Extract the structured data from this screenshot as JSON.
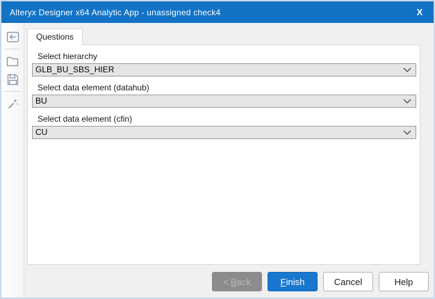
{
  "window": {
    "title": "Alteryx Designer x64 Analytic App - unassigned check4",
    "close_glyph": "X"
  },
  "colors": {
    "titlebar_blue": "#1273c6",
    "primary_button_blue": "#1877cf",
    "disabled_button_gray": "#8c8c8c",
    "combo_gray": "#e5e5e5",
    "window_border": "#c9d8ea"
  },
  "sidebar": {
    "icons": [
      {
        "name": "back-panel-icon"
      },
      {
        "name": "open-folder-icon"
      },
      {
        "name": "save-icon"
      },
      {
        "name": "magic-wand-icon"
      }
    ]
  },
  "tabs": [
    {
      "label": "Questions"
    }
  ],
  "questions": [
    {
      "label": "Select hierarchy",
      "value": "GLB_BU_SBS_HIER"
    },
    {
      "label": "Select data element (datahub)",
      "value": "BU"
    },
    {
      "label": "Select data element (cfin)",
      "value": "CU"
    }
  ],
  "buttons": {
    "back": {
      "prefix": "<",
      "mnemonic": "B",
      "rest": "ack"
    },
    "finish": {
      "mnemonic": "F",
      "rest": "inish"
    },
    "cancel": "Cancel",
    "help": "Help"
  }
}
